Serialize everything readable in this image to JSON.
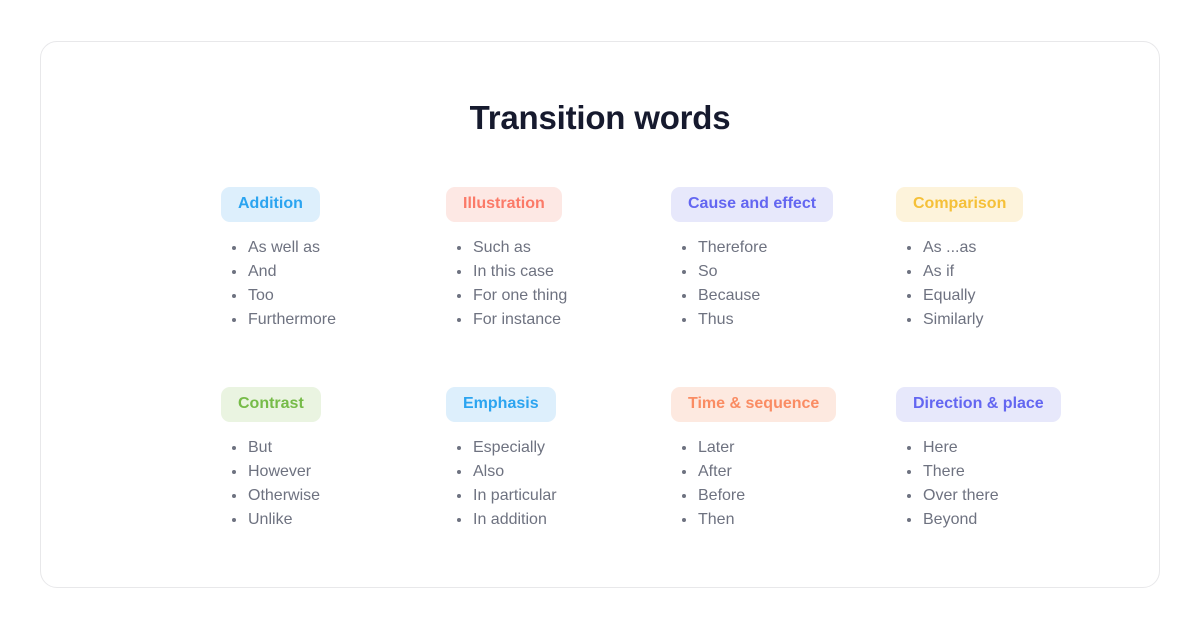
{
  "card": {
    "title": "Transition words"
  },
  "categories": [
    {
      "label": "Addition",
      "pill_bg": "#ddeffc",
      "pill_fg": "#2ba4f0",
      "words": [
        "As well as",
        "And",
        "Too",
        "Furthermore"
      ]
    },
    {
      "label": "Illustration",
      "pill_bg": "#fde8e4",
      "pill_fg": "#fb7a68",
      "words": [
        "Such as",
        "In this case",
        "For one thing",
        "For instance"
      ]
    },
    {
      "label": "Cause and effect",
      "pill_bg": "#e7e8fb",
      "pill_fg": "#6366f1",
      "words": [
        "Therefore",
        "So",
        "Because",
        "Thus"
      ]
    },
    {
      "label": "Comparison",
      "pill_bg": "#fdf3db",
      "pill_fg": "#f5c038",
      "words": [
        "As ...as",
        "As if",
        "Equally",
        "Similarly"
      ]
    },
    {
      "label": "Contrast",
      "pill_bg": "#eaf4e1",
      "pill_fg": "#76bb48",
      "words": [
        "But",
        "However",
        "Otherwise",
        "Unlike"
      ]
    },
    {
      "label": "Emphasis",
      "pill_bg": "#ddeffc",
      "pill_fg": "#2ba4f0",
      "words": [
        "Especially",
        "Also",
        "In particular",
        "In addition"
      ]
    },
    {
      "label": "Time & sequence",
      "pill_bg": "#fde9e0",
      "pill_fg": "#fa8c63",
      "words": [
        "Later",
        "After",
        "Before",
        "Then"
      ]
    },
    {
      "label": "Direction & place",
      "pill_bg": "#e7e8fb",
      "pill_fg": "#6366f1",
      "words": [
        "Here",
        "There",
        "Over there",
        "Beyond"
      ]
    }
  ]
}
